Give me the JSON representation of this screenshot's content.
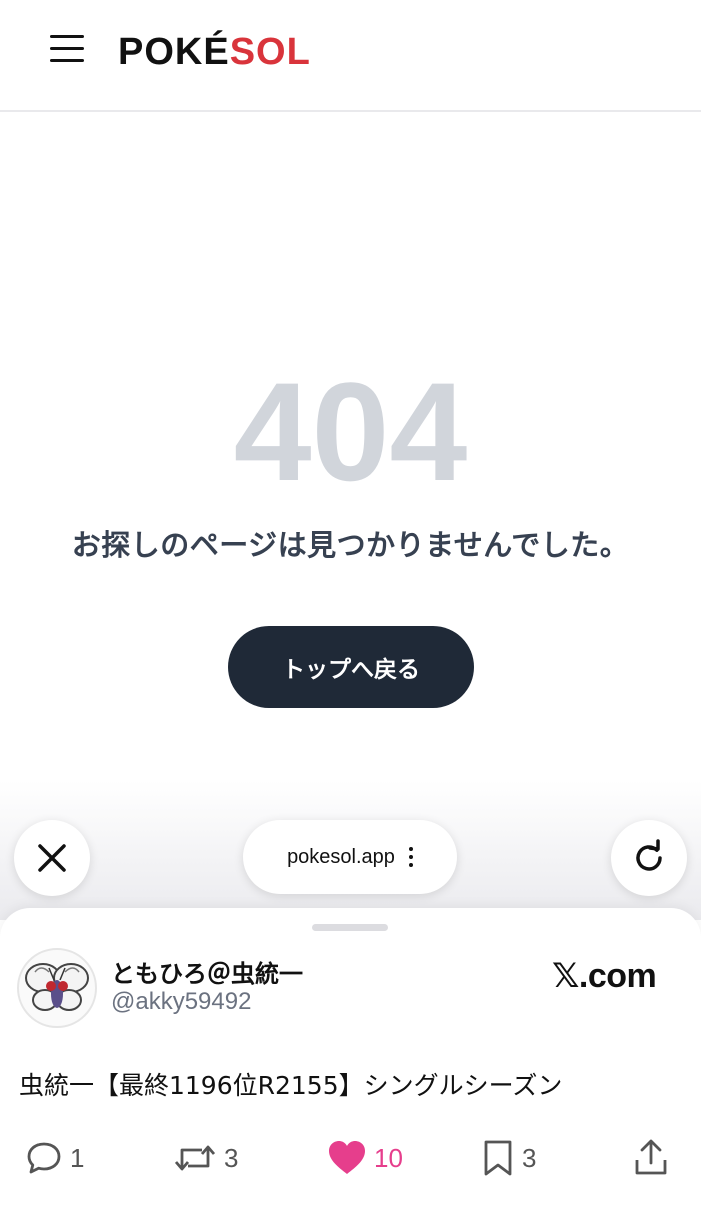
{
  "header": {
    "logo_part1": "POKÉ",
    "logo_part2": "SOL",
    "menu_icon": "hamburger-icon"
  },
  "main": {
    "code": "404",
    "message": "お探しのページは見つかりませんでした。",
    "top_button_label": "トップへ戻る"
  },
  "browser": {
    "close_icon": "close-icon",
    "url": "pokesol.app",
    "more_icon": "more-vertical-icon",
    "reload_icon": "reload-icon"
  },
  "sheet": {
    "display_name": "ともひろ＠虫統一",
    "handle": "@akky59492",
    "source_x": "𝕏",
    "source_domain": ".com",
    "tweet_text": "虫統一【最終1196位R2155】シングルシーズン",
    "actions": {
      "reply_count": "1",
      "retweet_count": "3",
      "like_count": "10",
      "bookmark_count": "3"
    }
  },
  "colors": {
    "brand_red": "#d9343b",
    "dark_button": "#1f2937",
    "muted_404": "#d1d5db",
    "like_pink": "#e63e8c"
  }
}
